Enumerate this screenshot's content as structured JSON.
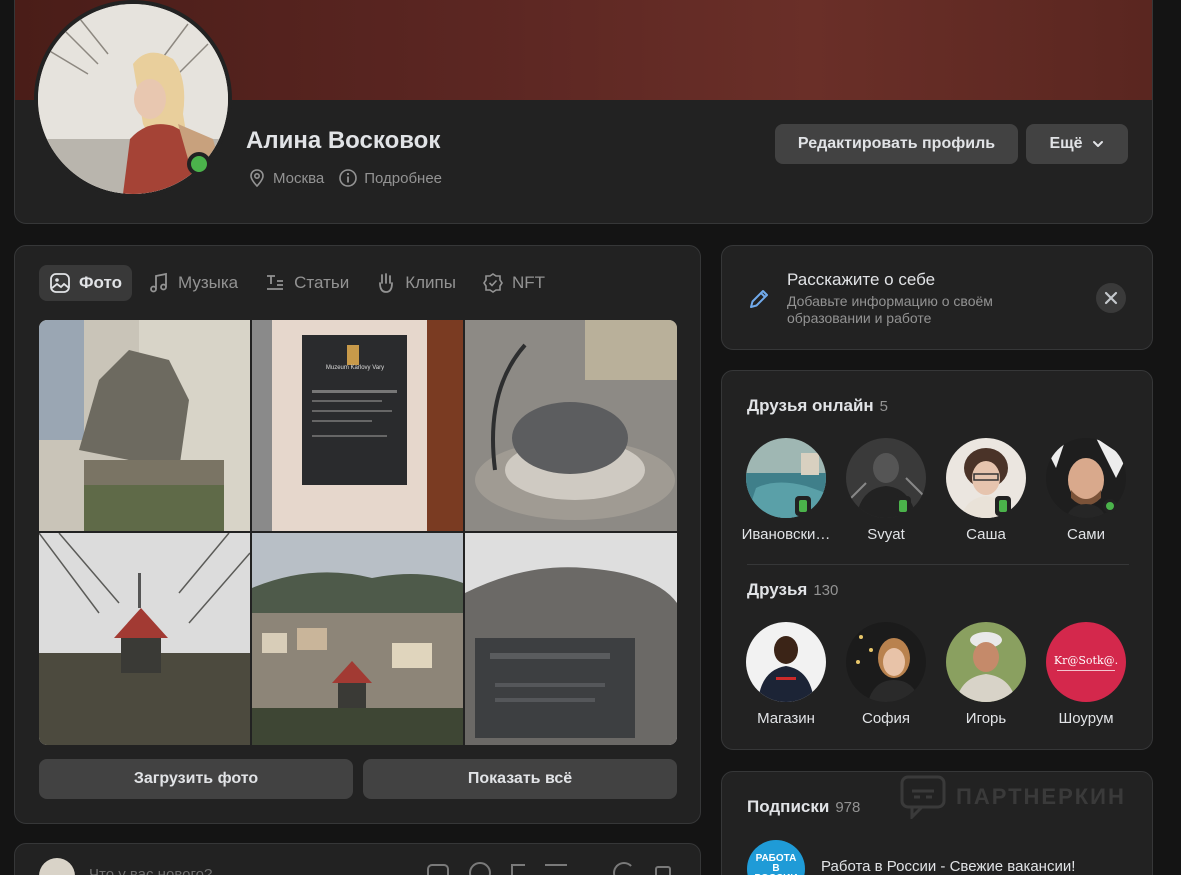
{
  "profile": {
    "name": "Алина Восковок",
    "city": "Москва",
    "more_info": "Подробнее",
    "edit_button": "Редактировать профиль",
    "more_button": "Ещё"
  },
  "media_tabs": [
    {
      "label": "Фото",
      "icon": "image-icon",
      "active": true
    },
    {
      "label": "Музыка",
      "icon": "music-icon",
      "active": false
    },
    {
      "label": "Статьи",
      "icon": "article-icon",
      "active": false
    },
    {
      "label": "Клипы",
      "icon": "clips-icon",
      "active": false
    },
    {
      "label": "NFT",
      "icon": "nft-icon",
      "active": false
    }
  ],
  "photos": [
    {
      "name": "photo-griffin-statue",
      "text": ""
    },
    {
      "name": "photo-museum-sign",
      "text": "Muzeum Karlovy Vary"
    },
    {
      "name": "photo-stone-egg",
      "text": ""
    },
    {
      "name": "photo-gazebo-tower",
      "text": ""
    },
    {
      "name": "photo-town-view",
      "text": ""
    },
    {
      "name": "photo-memorial-plaque",
      "text": ""
    }
  ],
  "photo_actions": {
    "upload": "Загрузить фото",
    "show_all": "Показать всё"
  },
  "composer": {
    "placeholder": "Что у вас нового?"
  },
  "about": {
    "title": "Расскажите о себе",
    "subtitle": "Добавьте информацию о своём образовании и работе"
  },
  "friends_online": {
    "title": "Друзья онлайн",
    "count": "5",
    "items": [
      {
        "name": "Ивановски…",
        "status": "mobile"
      },
      {
        "name": "Svyat",
        "status": "mobile"
      },
      {
        "name": "Саша",
        "status": "mobile"
      },
      {
        "name": "Сами",
        "status": "online"
      }
    ]
  },
  "friends": {
    "title": "Друзья",
    "count": "130",
    "items": [
      {
        "name": "Магазин"
      },
      {
        "name": "София"
      },
      {
        "name": "Игорь"
      },
      {
        "name": "Шоурум",
        "logo_text": "Kr@Sotk@."
      }
    ]
  },
  "subscriptions": {
    "title": "Подписки",
    "count": "978",
    "first_item": "Работа в России - Свежие вакансии!",
    "first_item_logo": "РАБОТА В РОССИИ"
  },
  "watermark": "ПАРТНЕРКИН",
  "colors": {
    "background": "#141414",
    "card": "#222222",
    "button": "#424242",
    "online": "#4bb34b",
    "accent": "#71aaeb",
    "muted": "#939393"
  }
}
